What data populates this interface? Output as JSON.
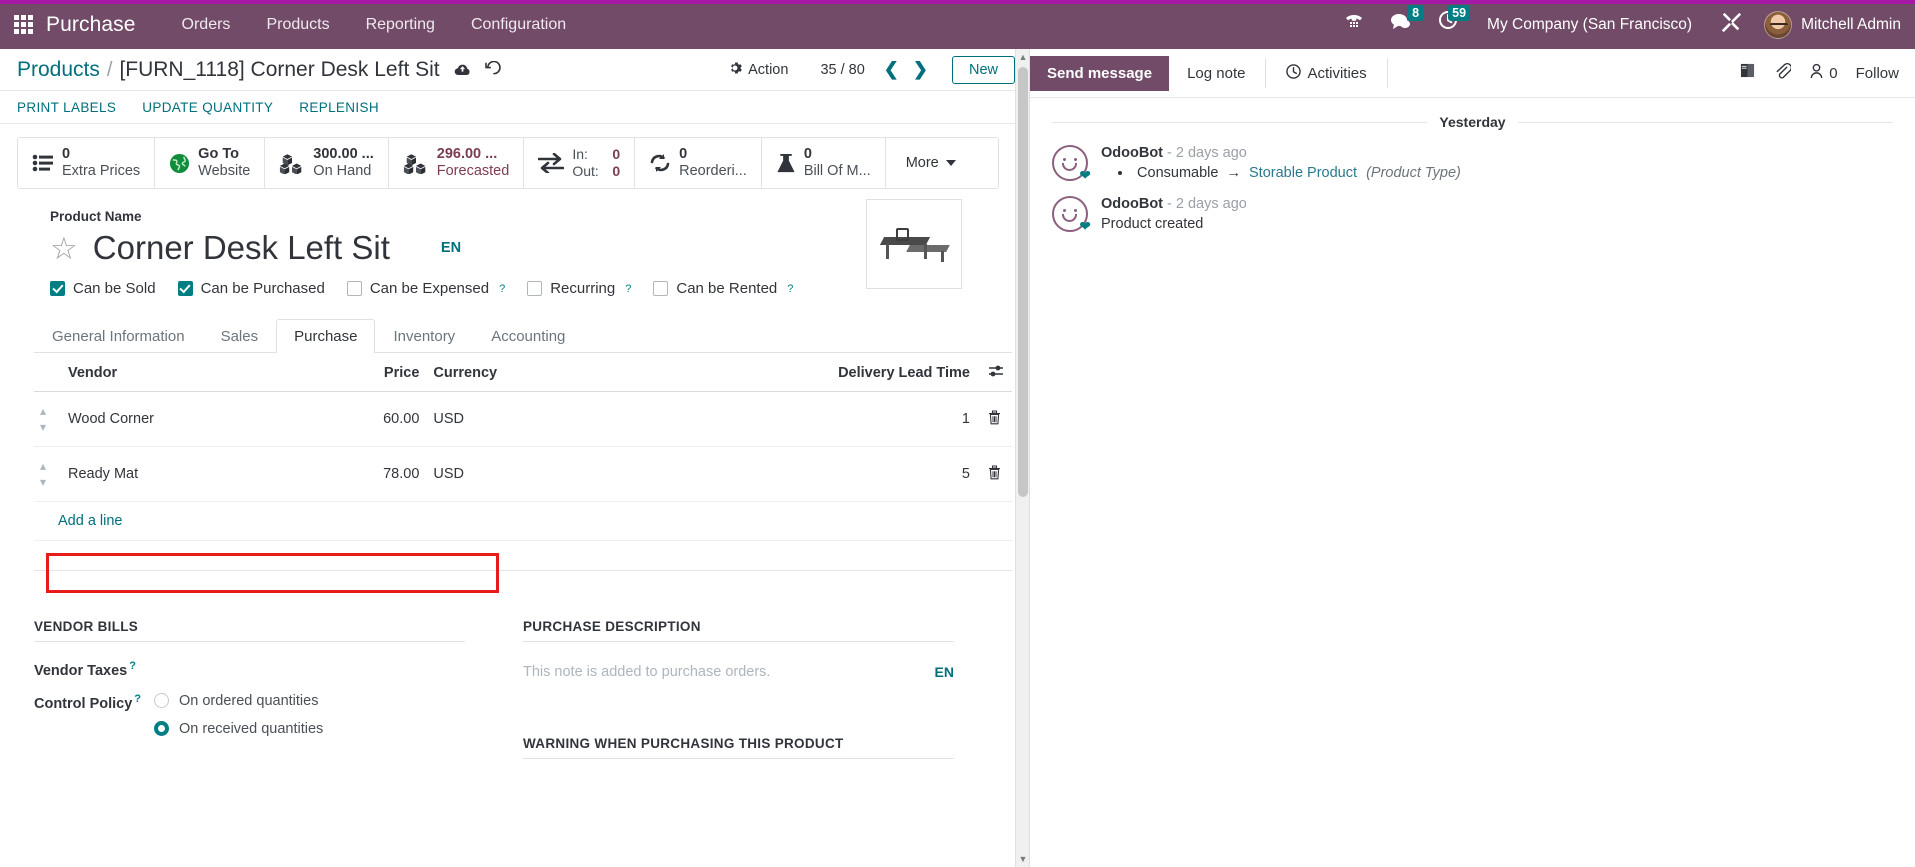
{
  "navbar": {
    "apps_icon": "apps-grid-icon",
    "brand": "Purchase",
    "menus": [
      "Orders",
      "Products",
      "Reporting",
      "Configuration"
    ],
    "icons": [
      {
        "name": "voip-phone-icon",
        "glyph": "☎",
        "badge": null
      },
      {
        "name": "messages-icon",
        "glyph": "💬",
        "badge": "8"
      },
      {
        "name": "activities-clock-icon",
        "glyph": "◴",
        "badge": "59"
      }
    ],
    "company": "My Company (San Francisco)",
    "debug_icon": "developer-tools-icon",
    "user": "Mitchell Admin",
    "brand_color": "#714b67",
    "badge_color": "#017e84"
  },
  "control_panel": {
    "breadcrumb_root": "Products",
    "breadcrumb_separator": "/",
    "breadcrumb_current": "[FURN_1118] Corner Desk Left Sit",
    "save_icon": "cloud-save-icon",
    "discard_icon": "discard-undo-icon",
    "action_label": "Action",
    "action_icon": "gear-icon",
    "pager": "35 / 80",
    "prev_icon": "chevron-left-icon",
    "next_icon": "chevron-right-icon",
    "new_label": "New"
  },
  "action_buttons": [
    "PRINT LABELS",
    "UPDATE QUANTITY",
    "REPLENISH"
  ],
  "stat_buttons": [
    {
      "name": "extra-prices",
      "icon": "list-icon",
      "value": "0",
      "label": "Extra Prices",
      "accent": "dark"
    },
    {
      "name": "go-to-website",
      "icon": "globe-icon",
      "value": "Go To",
      "label": "Website",
      "accent": "dark"
    },
    {
      "name": "on-hand",
      "icon": "boxes-icon",
      "value": "300.00 ...",
      "label": "On Hand",
      "accent": "dark"
    },
    {
      "name": "forecasted",
      "icon": "boxes-icon",
      "value": "296.00 ...",
      "label": "Forecasted",
      "accent": "maroon"
    },
    {
      "name": "in-out",
      "icon": "exchange-arrows-icon",
      "in_label": "In:",
      "in_value": "0",
      "out_label": "Out:",
      "out_value": "0"
    },
    {
      "name": "reordering-rules",
      "icon": "refresh-icon",
      "value": "0",
      "label": "Reorderi...",
      "accent": "dark"
    },
    {
      "name": "bill-of-materials",
      "icon": "flask-icon",
      "value": "0",
      "label": "Bill Of M...",
      "accent": "dark"
    },
    {
      "name": "more",
      "label": "More",
      "icon": "caret-down-icon"
    }
  ],
  "product": {
    "name_label": "Product Name",
    "name": "Corner Desk Left Sit",
    "star_icon": "favorite-star-icon",
    "translate_badge": "EN",
    "image_alt": "corner-desk-photo",
    "checkboxes": [
      {
        "label": "Can be Sold",
        "checked": true,
        "help": false
      },
      {
        "label": "Can be Purchased",
        "checked": true,
        "help": false
      },
      {
        "label": "Can be Expensed",
        "checked": false,
        "help": true
      },
      {
        "label": "Recurring",
        "checked": false,
        "help": true
      },
      {
        "label": "Can be Rented",
        "checked": false,
        "help": true
      }
    ]
  },
  "notebook": {
    "tabs": [
      "General Information",
      "Sales",
      "Purchase",
      "Inventory",
      "Accounting"
    ],
    "active_tab": "Purchase"
  },
  "vendor_table": {
    "columns": [
      "Vendor",
      "Price",
      "Currency",
      "Delivery Lead Time"
    ],
    "optional_columns_icon": "column-options-icon",
    "rows": [
      {
        "vendor": "Wood Corner",
        "price": "60.00",
        "currency": "USD",
        "lead_time": "1",
        "highlighted": true
      },
      {
        "vendor": "Ready Mat",
        "price": "78.00",
        "currency": "USD",
        "lead_time": "5",
        "highlighted": false
      }
    ],
    "add_line_label": "Add a line",
    "delete_icon": "trash-icon",
    "drag_icon": "drag-handle-icon",
    "highlight_color": "#e81b1b"
  },
  "vendor_bills": {
    "title": "VENDOR BILLS",
    "vendor_taxes_label": "Vendor Taxes",
    "vendor_taxes_value": "",
    "control_policy_label": "Control Policy",
    "control_policy_options": [
      {
        "label": "On ordered quantities",
        "selected": false
      },
      {
        "label": "On received quantities",
        "selected": true
      }
    ]
  },
  "purchase_description": {
    "title": "PURCHASE DESCRIPTION",
    "placeholder": "This note is added to purchase orders.",
    "translate_badge": "EN",
    "warning_title": "WARNING WHEN PURCHASING THIS PRODUCT"
  },
  "chatter": {
    "send_message": "Send message",
    "log_note": "Log note",
    "activities": "Activities",
    "activities_icon": "clock-icon",
    "attachments_icon": "paperclip-icon",
    "knowledge_icon": "book-icon",
    "followers_icon": "user-icon",
    "followers_count": "0",
    "follow_label": "Follow",
    "date_separator": "Yesterday",
    "messages": [
      {
        "author": "OdooBot",
        "time": "- 2 days ago",
        "type": "tracking",
        "old_value": "Consumable",
        "arrow": "→",
        "new_value": "Storable Product",
        "field": "(Product Type)"
      },
      {
        "author": "OdooBot",
        "time": "- 2 days ago",
        "type": "simple",
        "body": "Product created"
      }
    ]
  },
  "scrollbar": {
    "up_icon": "caret-up-icon",
    "down_icon": "caret-down-icon"
  }
}
